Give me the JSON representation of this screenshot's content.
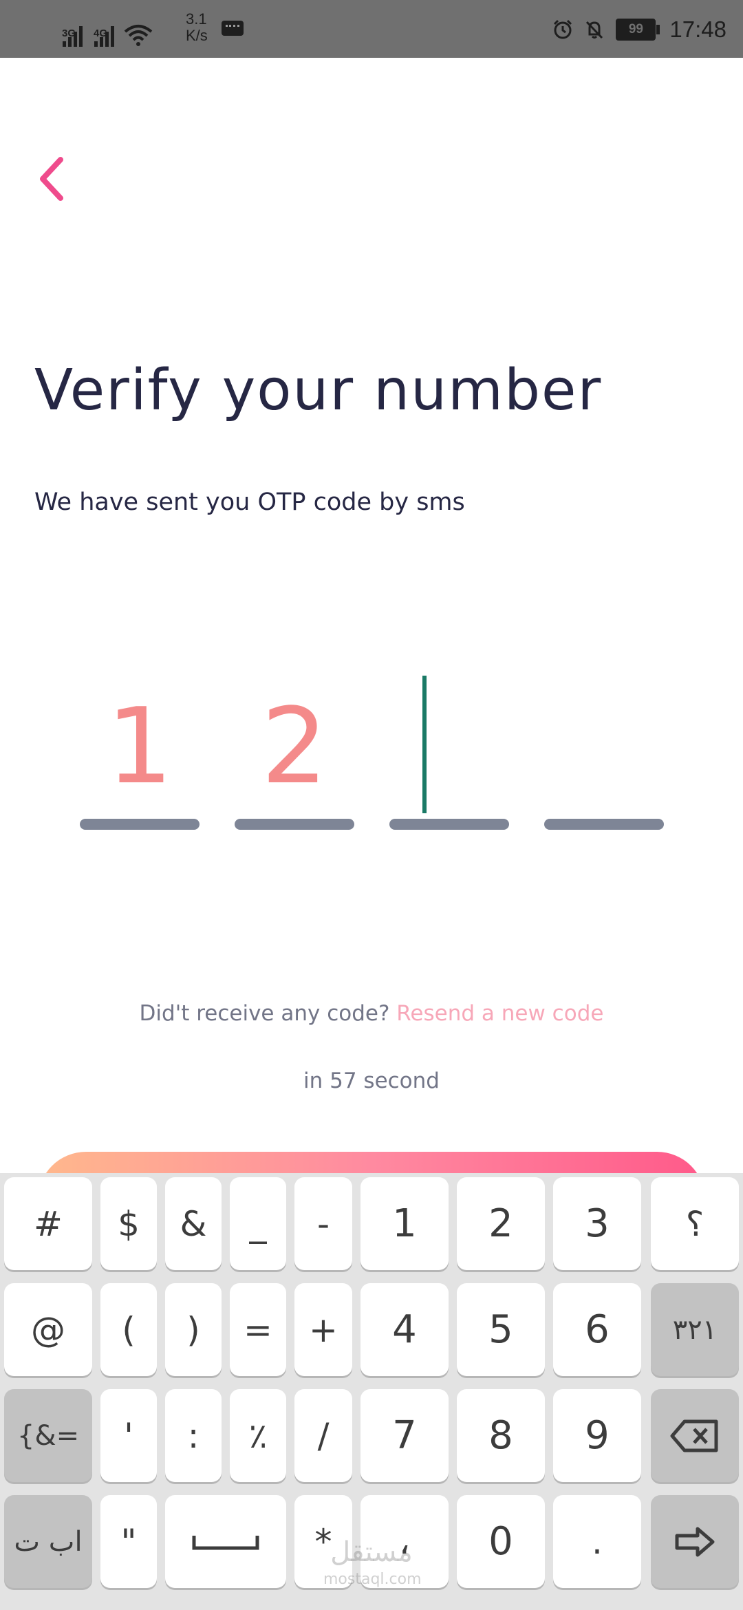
{
  "status_bar": {
    "network_1": "3G",
    "network_2": "4G",
    "speed_value": "3.1",
    "speed_unit": "K/s",
    "battery": "99",
    "time": "17:48"
  },
  "header": {
    "title": "Verify your number",
    "subtitle": "We have sent you OTP code by sms"
  },
  "otp": {
    "digits": [
      "1",
      "2",
      "",
      ""
    ]
  },
  "resend": {
    "prompt": "Did't receive any code?",
    "link": "Resend a new code",
    "timer": "in 57 second"
  },
  "colors": {
    "accent_pink": "#ef4b8c",
    "digit": "#f48a8a",
    "caret": "#1a7a66",
    "link": "#f7a7b8",
    "button_gradient": [
      "#ffb88c",
      "#ff5a8a"
    ]
  },
  "keyboard": {
    "row1": [
      "#",
      "$",
      "&",
      "_",
      "-",
      "1",
      "2",
      "3",
      "؟"
    ],
    "row2": [
      "@",
      "(",
      ")",
      "=",
      "+",
      "4",
      "5",
      "6",
      "٣٢١"
    ],
    "row3": [
      "{&=",
      "'",
      ":",
      "٪",
      "/",
      "7",
      "8",
      "9"
    ],
    "row4": [
      "اب ت",
      "\"",
      "*",
      "،",
      "0",
      "."
    ],
    "backspace_icon": "backspace-icon",
    "space_icon": "space-bar-icon",
    "enter_icon": "enter-arrow-icon"
  },
  "watermark": {
    "text": "مستقل",
    "sub": "mostaql.com"
  }
}
